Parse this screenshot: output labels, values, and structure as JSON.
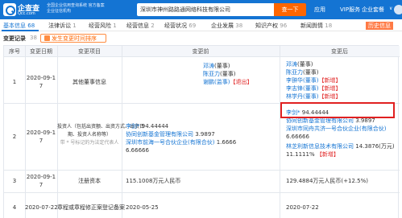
{
  "header": {
    "brand": "企查查",
    "brand_url": "Qcc.com",
    "slogan": "全国企业信用查询系统 官方备案企业征信机构",
    "search_value": "深圳市神州路路通网络科技有限公司",
    "search_button": "查一下",
    "nav": [
      "应用",
      "VIP服务",
      "企业套餐"
    ],
    "chev": "∨"
  },
  "tabs": [
    {
      "label": "基本信息",
      "num": "68"
    },
    {
      "label": "法律诉讼",
      "num": "1"
    },
    {
      "label": "经营风险",
      "num": "1"
    },
    {
      "label": "经营信息",
      "num": "2"
    },
    {
      "label": "经营状况",
      "num": "69"
    },
    {
      "label": "企业发展",
      "num": "38"
    },
    {
      "label": "知识产权",
      "num": "96"
    },
    {
      "label": "新闻舆情",
      "num": "18"
    },
    {
      "label": "历史信息",
      "num": ""
    }
  ],
  "section": {
    "title": "变更记录",
    "count": "38",
    "filter": "发生变更时间排序"
  },
  "table": {
    "headers": [
      "序号",
      "变更日期",
      "变更项目",
      "变更前",
      "变更后"
    ],
    "rows": [
      {
        "idx": "1",
        "date_a": "2020-09-1",
        "date_b": "7",
        "item": "其他董事信息",
        "before": [
          {
            "text": "邓涛",
            "tail": "(董事)"
          },
          {
            "text": "陈亚力",
            "tail": "(董事)"
          },
          {
            "text": "谢鹏(监事)",
            "tail": "【退出】",
            "red": true
          }
        ],
        "after": [
          {
            "text": "邓涛",
            "tail": "(董事)"
          },
          {
            "text": "陈亚力",
            "tail": "(董事)"
          },
          {
            "text": "李翀华(董事)",
            "tail": "【新增】",
            "red": true
          },
          {
            "text": "李志锋(董事)",
            "tail": "【新增】",
            "red": true
          },
          {
            "text": "林学丹(董事)",
            "tail": "【新增】",
            "red": true
          }
        ]
      },
      {
        "idx": "2",
        "date_a": "2020-09-1",
        "date_b": "7",
        "item_lines": [
          "投资人（包括出资额、出资方式、出资日",
          "期、投资人名称等）",
          "带 * 号标记的为法定代表人"
        ],
        "before": [
          {
            "text": "李剑*",
            "tail": "94.44444"
          },
          {
            "text": "协同创新基金管理有限公司",
            "tail": "3.9897"
          },
          {
            "text": "深圳市前海一号合伙企业(有限合伙)",
            "tail": "1.6666"
          },
          {
            "text": "6.66666",
            "tail": ""
          }
        ],
        "after": [
          {
            "text": "李剑*",
            "tail": "94.44444"
          },
          {
            "text": "协同创新基金管理有限公司",
            "tail": "3.9897"
          },
          {
            "text": "深圳市同舟共济一号合伙企业(有限合伙)",
            "tail": ""
          },
          {
            "text": "6.66666",
            "tail": ""
          },
          {
            "text": "林芝利新信息技术有限公司",
            "tail": "14.3876(万元)"
          },
          {
            "text": "11.1111%",
            "tail": "【新增】",
            "red": true
          }
        ]
      },
      {
        "idx": "3",
        "date_a": "2020-09-1",
        "date_b": "7",
        "item": "注册资本",
        "before_text": "115.1008万元人民币",
        "after_text": "129.4884万元人民币(+12.5%)"
      },
      {
        "idx": "4",
        "date_a": "2020-07-22",
        "item": "章程或章程修正案登记备案",
        "before_text": "2020-05-25",
        "after_text": "2020-07-22"
      }
    ]
  }
}
